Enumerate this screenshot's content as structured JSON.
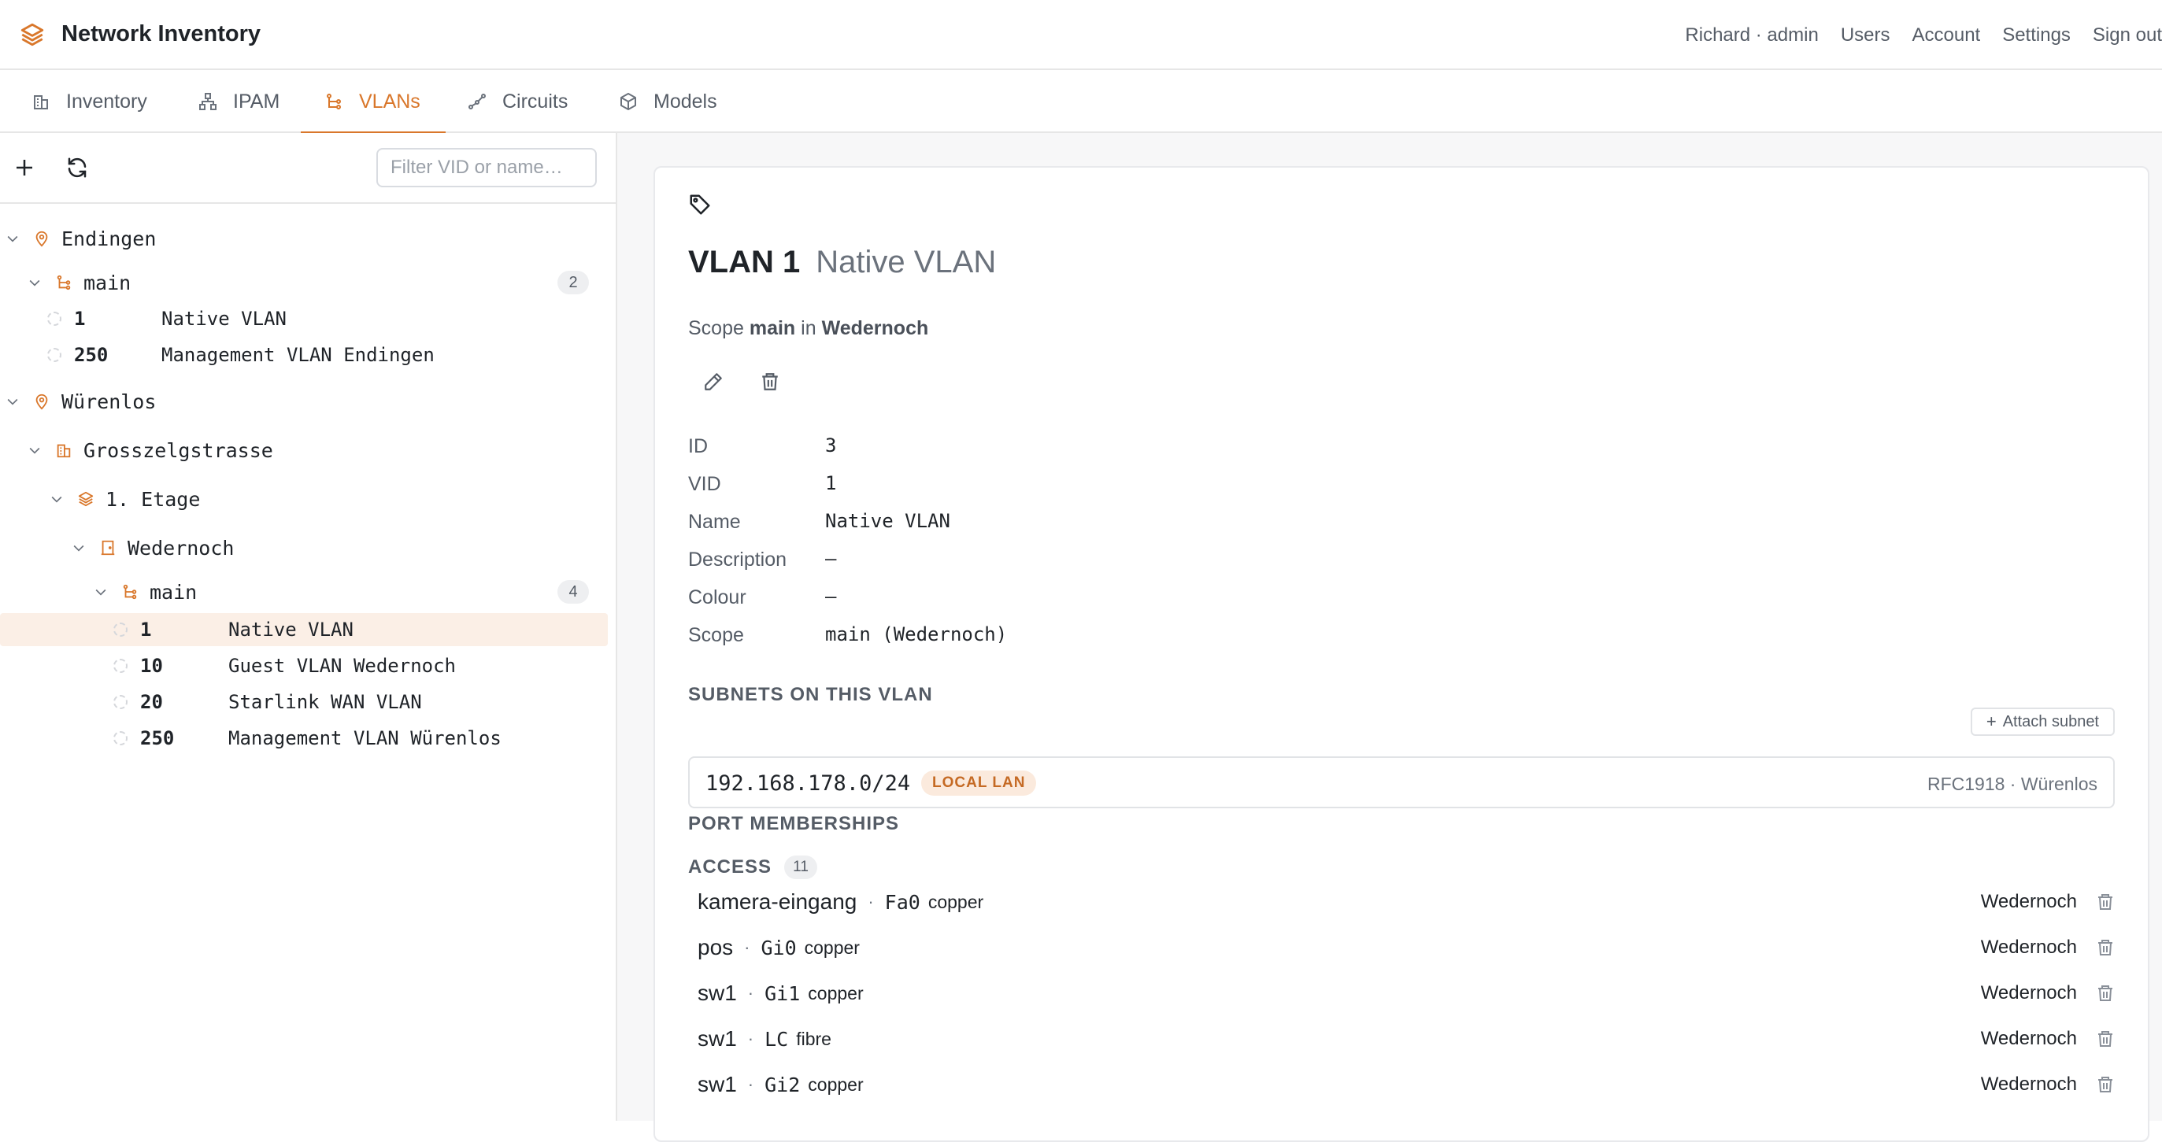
{
  "app": {
    "title": "Network Inventory",
    "nav": [
      "Richard · admin",
      "Users",
      "Account",
      "Settings",
      "Sign out"
    ]
  },
  "tabs": [
    {
      "label": "Inventory",
      "icon": "building-icon"
    },
    {
      "label": "IPAM",
      "icon": "network-icon"
    },
    {
      "label": "VLANs",
      "icon": "vlan-icon",
      "active": true
    },
    {
      "label": "Circuits",
      "icon": "circuit-icon"
    },
    {
      "label": "Models",
      "icon": "cube-icon"
    }
  ],
  "colors": {
    "accent": "#d9772b",
    "selected_bg": "#fbefe6"
  },
  "sidebar": {
    "filter_placeholder": "Filter VID or name…",
    "tree": [
      {
        "label": "Endingen",
        "type": "location"
      },
      {
        "label": "main",
        "type": "group",
        "count": "2"
      },
      {
        "vid": "1",
        "name": "Native VLAN"
      },
      {
        "vid": "250",
        "name": "Management VLAN Endingen"
      },
      {
        "label": "Würenlos",
        "type": "location"
      },
      {
        "label": "Grosszelgstrasse",
        "type": "building"
      },
      {
        "label": "1. Etage",
        "type": "floor"
      },
      {
        "label": "Wedernoch",
        "type": "room"
      },
      {
        "label": "main",
        "type": "group",
        "count": "4"
      },
      {
        "vid": "1",
        "name": "Native VLAN",
        "selected": true
      },
      {
        "vid": "10",
        "name": "Guest VLAN Wedernoch"
      },
      {
        "vid": "20",
        "name": "Starlink WAN VLAN"
      },
      {
        "vid": "250",
        "name": "Management VLAN Würenlos"
      }
    ]
  },
  "detail": {
    "vlan_title": "VLAN 1",
    "vlan_name": "Native VLAN",
    "scope_prefix": "Scope",
    "scope_group": "main",
    "scope_in": "in",
    "scope_site": "Wedernoch",
    "fields": [
      {
        "label": "ID",
        "value": "3"
      },
      {
        "label": "VID",
        "value": "1"
      },
      {
        "label": "Name",
        "value": "Native VLAN"
      },
      {
        "label": "Description",
        "value": "—"
      },
      {
        "label": "Colour",
        "value": "—"
      },
      {
        "label": "Scope",
        "value": "main (Wedernoch)"
      }
    ],
    "subnets_heading": "SUBNETS ON THIS VLAN",
    "attach_label": "Attach subnet",
    "subnet": {
      "cidr": "192.168.178.0/24",
      "badge": "LOCAL LAN",
      "meta": "RFC1918 · Würenlos"
    },
    "ports_heading": "PORT MEMBERSHIPS",
    "access_label": "ACCESS",
    "access_count": "11",
    "ports": [
      {
        "device": "kamera-eingang",
        "iface": "Fa0",
        "media": "copper",
        "site": "Wedernoch"
      },
      {
        "device": "pos",
        "iface": "Gi0",
        "media": "copper",
        "site": "Wedernoch"
      },
      {
        "device": "sw1",
        "iface": "Gi1",
        "media": "copper",
        "site": "Wedernoch"
      },
      {
        "device": "sw1",
        "iface": "LC",
        "media": "fibre",
        "site": "Wedernoch"
      },
      {
        "device": "sw1",
        "iface": "Gi2",
        "media": "copper",
        "site": "Wedernoch"
      }
    ]
  }
}
